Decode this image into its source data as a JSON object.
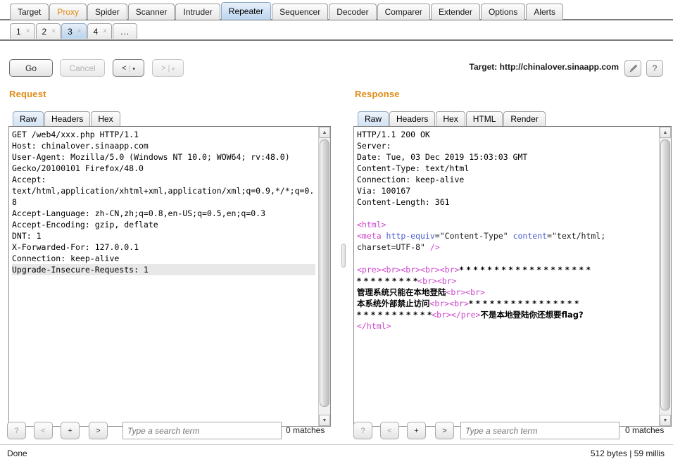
{
  "main_tabs": [
    {
      "label": "Target",
      "state": "normal"
    },
    {
      "label": "Proxy",
      "state": "proxy"
    },
    {
      "label": "Spider",
      "state": "normal"
    },
    {
      "label": "Scanner",
      "state": "normal"
    },
    {
      "label": "Intruder",
      "state": "normal"
    },
    {
      "label": "Repeater",
      "state": "active"
    },
    {
      "label": "Sequencer",
      "state": "normal"
    },
    {
      "label": "Decoder",
      "state": "normal"
    },
    {
      "label": "Comparer",
      "state": "normal"
    },
    {
      "label": "Extender",
      "state": "normal"
    },
    {
      "label": "Options",
      "state": "normal"
    },
    {
      "label": "Alerts",
      "state": "normal"
    }
  ],
  "repeater_tabs": [
    {
      "label": "1",
      "close": "×",
      "active": false
    },
    {
      "label": "2",
      "close": "×",
      "active": false
    },
    {
      "label": "3",
      "close": "×",
      "active": true
    },
    {
      "label": "4",
      "close": "×",
      "active": false
    },
    {
      "label": "...",
      "close": "",
      "active": false
    }
  ],
  "toolbar": {
    "go_label": "Go",
    "cancel_label": "Cancel",
    "prev_label": "<",
    "next_label": ">",
    "prev_caret": "▾",
    "next_caret": "▾",
    "separator": "|",
    "target_label": "Target: http://chinalover.sinaapp.com",
    "pencil_icon": "pencil-icon",
    "help_label": "?"
  },
  "request": {
    "title": "Request",
    "tabs": [
      {
        "label": "Raw",
        "active": true
      },
      {
        "label": "Headers",
        "active": false
      },
      {
        "label": "Hex",
        "active": false
      }
    ],
    "raw_lines": [
      "GET /web4/xxx.php HTTP/1.1",
      "Host: chinalover.sinaapp.com",
      "User-Agent: Mozilla/5.0 (Windows NT 10.0; WOW64; rv:48.0)",
      "Gecko/20100101 Firefox/48.0",
      "Accept:",
      "text/html,application/xhtml+xml,application/xml;q=0.9,*/*;q=0.",
      "8",
      "Accept-Language: zh-CN,zh;q=0.8,en-US;q=0.5,en;q=0.3",
      "Accept-Encoding: gzip, deflate",
      "DNT: 1",
      "X-Forwarded-For: 127.0.0.1",
      "Connection: keep-alive"
    ],
    "highlighted_line": "Upgrade-Insecure-Requests: 1",
    "search": {
      "help_label": "?",
      "prev_label": "<",
      "add_label": "+",
      "next_label": ">",
      "placeholder": "Type a search term",
      "value": "",
      "matches": "0 matches"
    }
  },
  "response": {
    "title": "Response",
    "tabs": [
      {
        "label": "Raw",
        "active": true
      },
      {
        "label": "Headers",
        "active": false
      },
      {
        "label": "Hex",
        "active": false
      },
      {
        "label": "HTML",
        "active": false
      },
      {
        "label": "Render",
        "active": false
      }
    ],
    "header_lines": [
      "HTTP/1.1 200 OK",
      "Server:",
      "Date: Tue, 03 Dec 2019 15:03:03 GMT",
      "Content-Type: text/html",
      "Connection: keep-alive",
      "Via: 100167",
      "Content-Length: 361"
    ],
    "body_tokens": [
      [
        {
          "t": "tag",
          "s": "<html>"
        }
      ],
      [
        {
          "t": "tag",
          "s": "<meta "
        },
        {
          "t": "attr",
          "s": "http-equiv"
        },
        {
          "t": "val",
          "s": "=\"Content-Type\" "
        },
        {
          "t": "attr",
          "s": "content"
        },
        {
          "t": "val",
          "s": "=\"text/html;"
        }
      ],
      [
        {
          "t": "val",
          "s": "charset=UTF-8\" "
        },
        {
          "t": "tag",
          "s": "/>"
        }
      ],
      [
        {
          "t": "val",
          "s": ""
        }
      ],
      [
        {
          "t": "tag",
          "s": "<pre>"
        },
        {
          "t": "tag",
          "s": "<br>"
        },
        {
          "t": "tag",
          "s": "<br>"
        },
        {
          "t": "tag",
          "s": "<br>"
        },
        {
          "t": "tag",
          "s": "<br>"
        },
        {
          "t": "cjk",
          "s": "* * * * * * * * * * * * * * * * * * *"
        }
      ],
      [
        {
          "t": "cjk",
          "s": "* * * * * * * * *"
        },
        {
          "t": "tag",
          "s": "<br>"
        },
        {
          "t": "tag",
          "s": "<br>"
        }
      ],
      [
        {
          "t": "cjk",
          "s": "管理系统只能在本地登陆"
        },
        {
          "t": "tag",
          "s": "<br>"
        },
        {
          "t": "tag",
          "s": "<br>"
        }
      ],
      [
        {
          "t": "cjk",
          "s": "本系统外部禁止访问"
        },
        {
          "t": "tag",
          "s": "<br>"
        },
        {
          "t": "tag",
          "s": "<br>"
        },
        {
          "t": "cjk",
          "s": "* * * * * * * * * * * * * * * *"
        }
      ],
      [
        {
          "t": "cjk",
          "s": "* * * * * * * * * * *"
        },
        {
          "t": "tag",
          "s": "<br>"
        },
        {
          "t": "tag",
          "s": "</pre>"
        },
        {
          "t": "cjk",
          "s": "不是本地登陆你还想要flag?"
        }
      ],
      [
        {
          "t": "tag",
          "s": "</html>"
        }
      ]
    ],
    "search": {
      "help_label": "?",
      "prev_label": "<",
      "add_label": "+",
      "next_label": ">",
      "placeholder": "Type a search term",
      "value": "",
      "matches": "0 matches"
    }
  },
  "statusbar": {
    "left": "Done",
    "right": "512 bytes | 59 millis"
  },
  "colors": {
    "accent_orange": "#e08a14",
    "tab_active_blue": "#cddff2",
    "tag_magenta": "#cc44cc",
    "attr_blue": "#4a5fd0"
  }
}
